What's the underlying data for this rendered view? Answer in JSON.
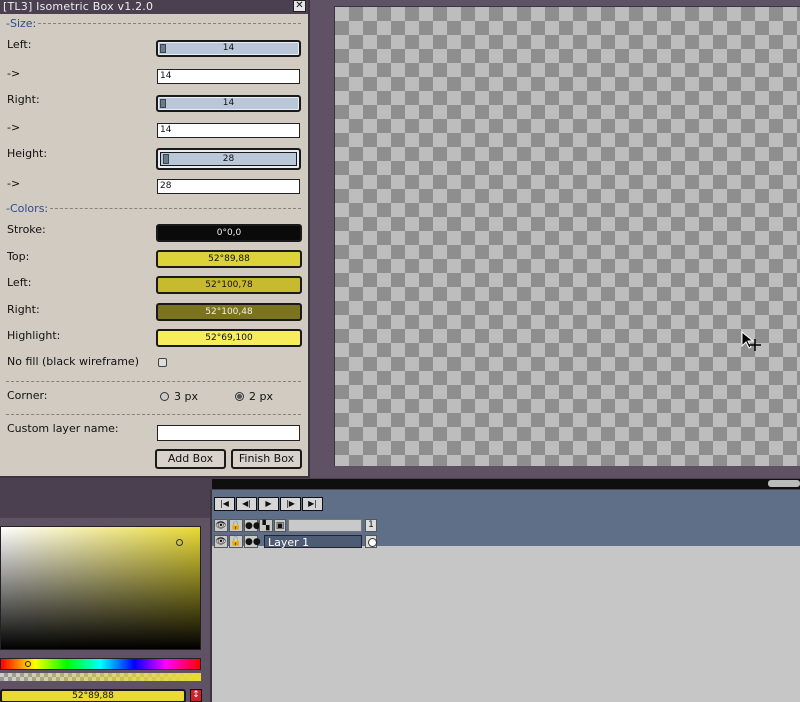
{
  "dialog": {
    "title": "[TL3] Isometric Box v1.2.0",
    "close_glyph": "✕",
    "size_section": "-Size:",
    "colors_section": "-Colors:",
    "left_label": "Left:",
    "left_value": "14",
    "left_text": "14",
    "arrow_label": "->",
    "right_label": "Right:",
    "right_value": "14",
    "right_text": "14",
    "height_label": "Height:",
    "height_value": "28",
    "height_text": "28",
    "stroke_label": "Stroke:",
    "stroke_value": "0°0,0",
    "stroke_color": "#0a0a0a",
    "top_label": "Top:",
    "top_value": "52°89,88",
    "top_color": "#dcd23a",
    "leftc_label": "Left:",
    "leftc_value": "52°100,78",
    "leftc_color": "#c7ba2f",
    "rightc_label": "Right:",
    "rightc_value": "52°100,48",
    "rightc_color": "#7c731e",
    "highlight_label": "Highlight:",
    "highlight_value": "52°69,100",
    "highlight_color": "#f5ed5c",
    "nofill_label": "No fill (black wireframe)",
    "corner_label": "Corner:",
    "corner_opt1": "3 px",
    "corner_opt2": "2 px",
    "layer_name_label": "Custom layer name:",
    "layer_name_value": "",
    "add_box": "Add Box",
    "finish_box": "Finish Box"
  },
  "color_panel": {
    "value": "52°89,88",
    "swap_glyph": "↕"
  },
  "timeline": {
    "buttons": [
      "|◀",
      "◀|",
      "▶",
      "|▶",
      "▶|"
    ],
    "frame_number": "1",
    "layer_name": "Layer 1",
    "header_icons": [
      "👁",
      "🔒",
      "●●",
      "▚",
      "▣"
    ],
    "row_icons": [
      "👁",
      "🔓",
      "●●"
    ]
  }
}
